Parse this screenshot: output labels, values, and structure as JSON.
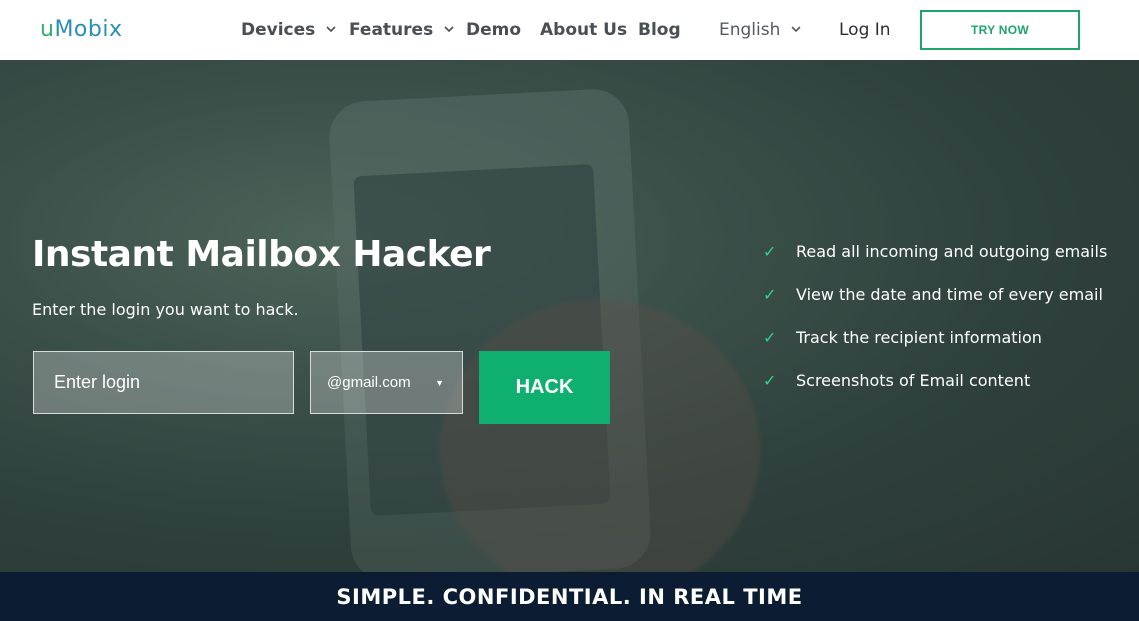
{
  "logo": {
    "prefix": "u",
    "rest": "Mobix"
  },
  "nav": {
    "devices": "Devices",
    "features": "Features",
    "demo": "Demo",
    "about": "About Us",
    "blog": "Blog",
    "language": "English",
    "login": "Log In",
    "try_now": "TRY NOW",
    "chevron": "⌄"
  },
  "hero": {
    "title": "Instant Mailbox Hacker",
    "subtitle": "Enter the login you want to hack.",
    "login_placeholder": "Enter login",
    "domain_selected": "@gmail.com",
    "domain_caret": "▼",
    "hack_label": "HACK",
    "features": [
      "Read all incoming and outgoing emails",
      "View the date and time of every email",
      "Track the recipient information",
      "Screenshots of Email content"
    ],
    "check_glyph": "✓"
  },
  "bottom": {
    "tagline": "SIMPLE. CONFIDENTIAL. IN REAL TIME"
  },
  "colors": {
    "brand_green": "#0fb06f",
    "brand_blue": "#2a8fb7",
    "bar_navy": "#0c1d33"
  }
}
